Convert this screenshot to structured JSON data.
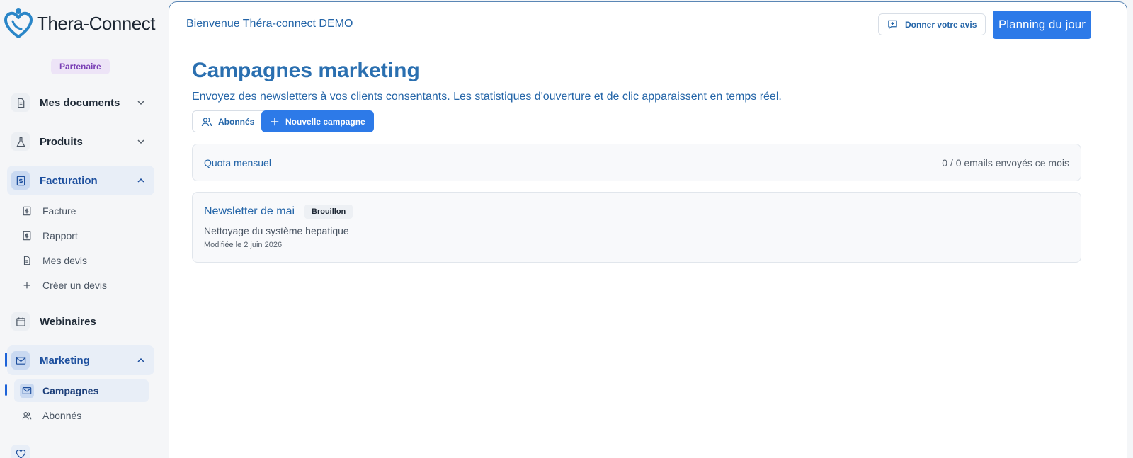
{
  "brand": {
    "name": "Thera-Connect",
    "badge": "Partenaire"
  },
  "sidebar": {
    "items": [
      {
        "label": "Mes documents"
      },
      {
        "label": "Produits"
      },
      {
        "label": "Facturation"
      },
      {
        "label": "Webinaires"
      },
      {
        "label": "Marketing"
      }
    ],
    "facturation_sub": [
      {
        "label": "Facture"
      },
      {
        "label": "Rapport"
      },
      {
        "label": "Mes devis"
      },
      {
        "label": "Créer un devis"
      }
    ],
    "marketing_sub": [
      {
        "label": "Campagnes"
      },
      {
        "label": "Abonnés"
      }
    ]
  },
  "header": {
    "welcome": "Bienvenue Théra-connect DEMO",
    "feedback_label": "Donner votre avis",
    "planning_label": "Planning du jour"
  },
  "page": {
    "title": "Campagnes marketing",
    "subtitle": "Envoyez des newsletters à vos clients consentants. Les statistiques d'ouverture et de clic apparaissent en temps réel.",
    "subscribers_button": "Abonnés",
    "new_campaign_button": "Nouvelle campagne"
  },
  "quota": {
    "label": "Quota mensuel",
    "value": "0 / 0 emails envoyés ce mois"
  },
  "campaigns": [
    {
      "title": "Newsletter de mai",
      "status": "Brouillon",
      "description": "Nettoyage du système hepatique",
      "modified": "Modifiée le 2 juin 2026"
    }
  ],
  "colors": {
    "accent": "#2d7ae8",
    "brand_text": "#2465a8",
    "badge_bg": "#ede4f7"
  }
}
